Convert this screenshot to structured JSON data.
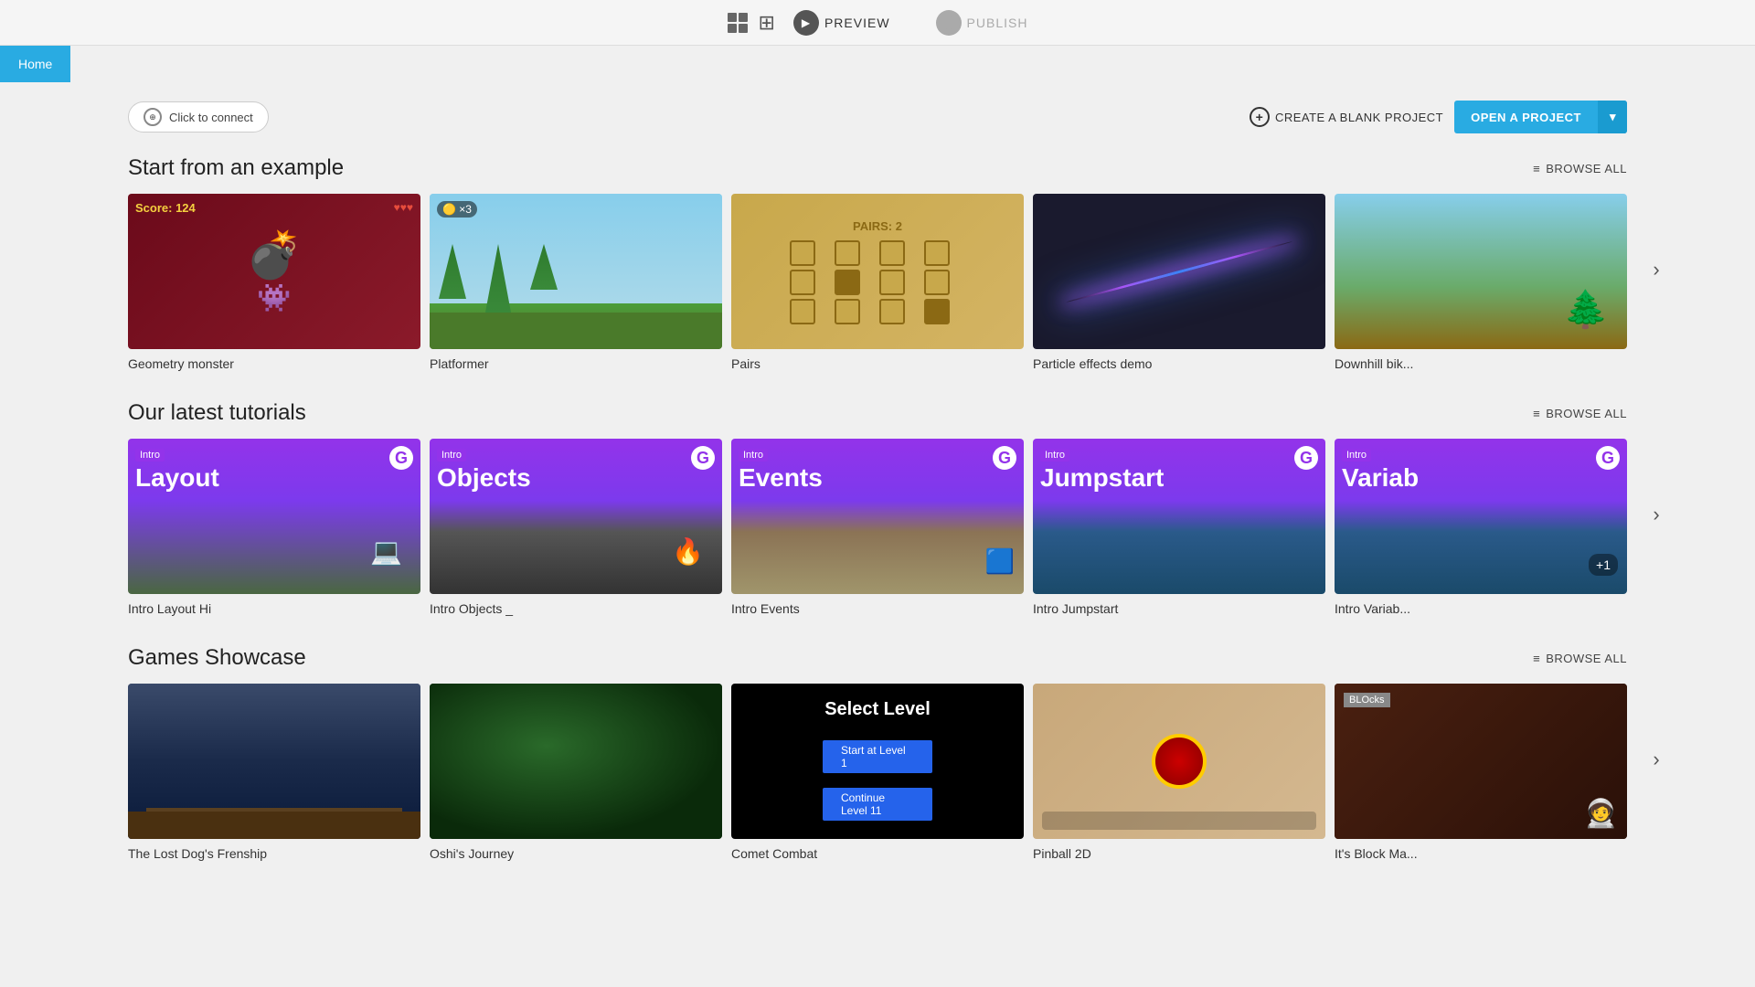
{
  "header": {
    "preview_label": "PREVIEW",
    "publish_label": "PUBLISH"
  },
  "nav": {
    "home_label": "Home"
  },
  "topbar": {
    "connect_label": "Click to connect",
    "create_blank_label": "CREATE A BLANK PROJECT",
    "open_project_label": "OPEN A PROJECT"
  },
  "examples": {
    "title": "Start from an example",
    "browse_all": "BROWSE ALL",
    "items": [
      {
        "label": "Geometry monster",
        "thumb": "geometry"
      },
      {
        "label": "Platformer",
        "thumb": "platformer"
      },
      {
        "label": "Pairs",
        "thumb": "pairs"
      },
      {
        "label": "Particle effects demo",
        "thumb": "particles"
      },
      {
        "label": "Downhill bik...",
        "thumb": "downhill"
      }
    ]
  },
  "tutorials": {
    "title": "Our latest tutorials",
    "browse_all": "BROWSE ALL",
    "items": [
      {
        "label": "Intro Layout Hi",
        "badge": "Intro",
        "title": "Layout",
        "thumb": "layout"
      },
      {
        "label": "Intro Objects _",
        "badge": "Intro",
        "title": "Objects",
        "thumb": "objects"
      },
      {
        "label": "Intro Events",
        "badge": "Intro",
        "title": "Events",
        "thumb": "events"
      },
      {
        "label": "Intro Jumpstart",
        "badge": "Intro",
        "title": "Jumpstart",
        "thumb": "jumpstart"
      },
      {
        "label": "Intro Variab...",
        "badge": "Intro",
        "title": "Variab",
        "thumb": "variable"
      }
    ]
  },
  "showcase": {
    "title": "Games Showcase",
    "browse_all": "BROWSE ALL",
    "items": [
      {
        "label": "The Lost Dog's Frenship",
        "thumb": "lostdog"
      },
      {
        "label": "Oshi's Journey",
        "thumb": "oshi"
      },
      {
        "label": "Comet Combat",
        "thumb": "comet"
      },
      {
        "label": "Pinball 2D",
        "thumb": "pinball"
      },
      {
        "label": "It's Block Ma...",
        "thumb": "blocks"
      }
    ]
  },
  "geometry_score": "Score: 124",
  "geometry_hearts": "♥♥♥",
  "platformer_lives": "×3",
  "pairs_title": "PAIRS: 2",
  "select_level_title": "Select Level",
  "select_level_btn1": "Start at Level 1",
  "select_level_btn2": "Continue Level 11"
}
